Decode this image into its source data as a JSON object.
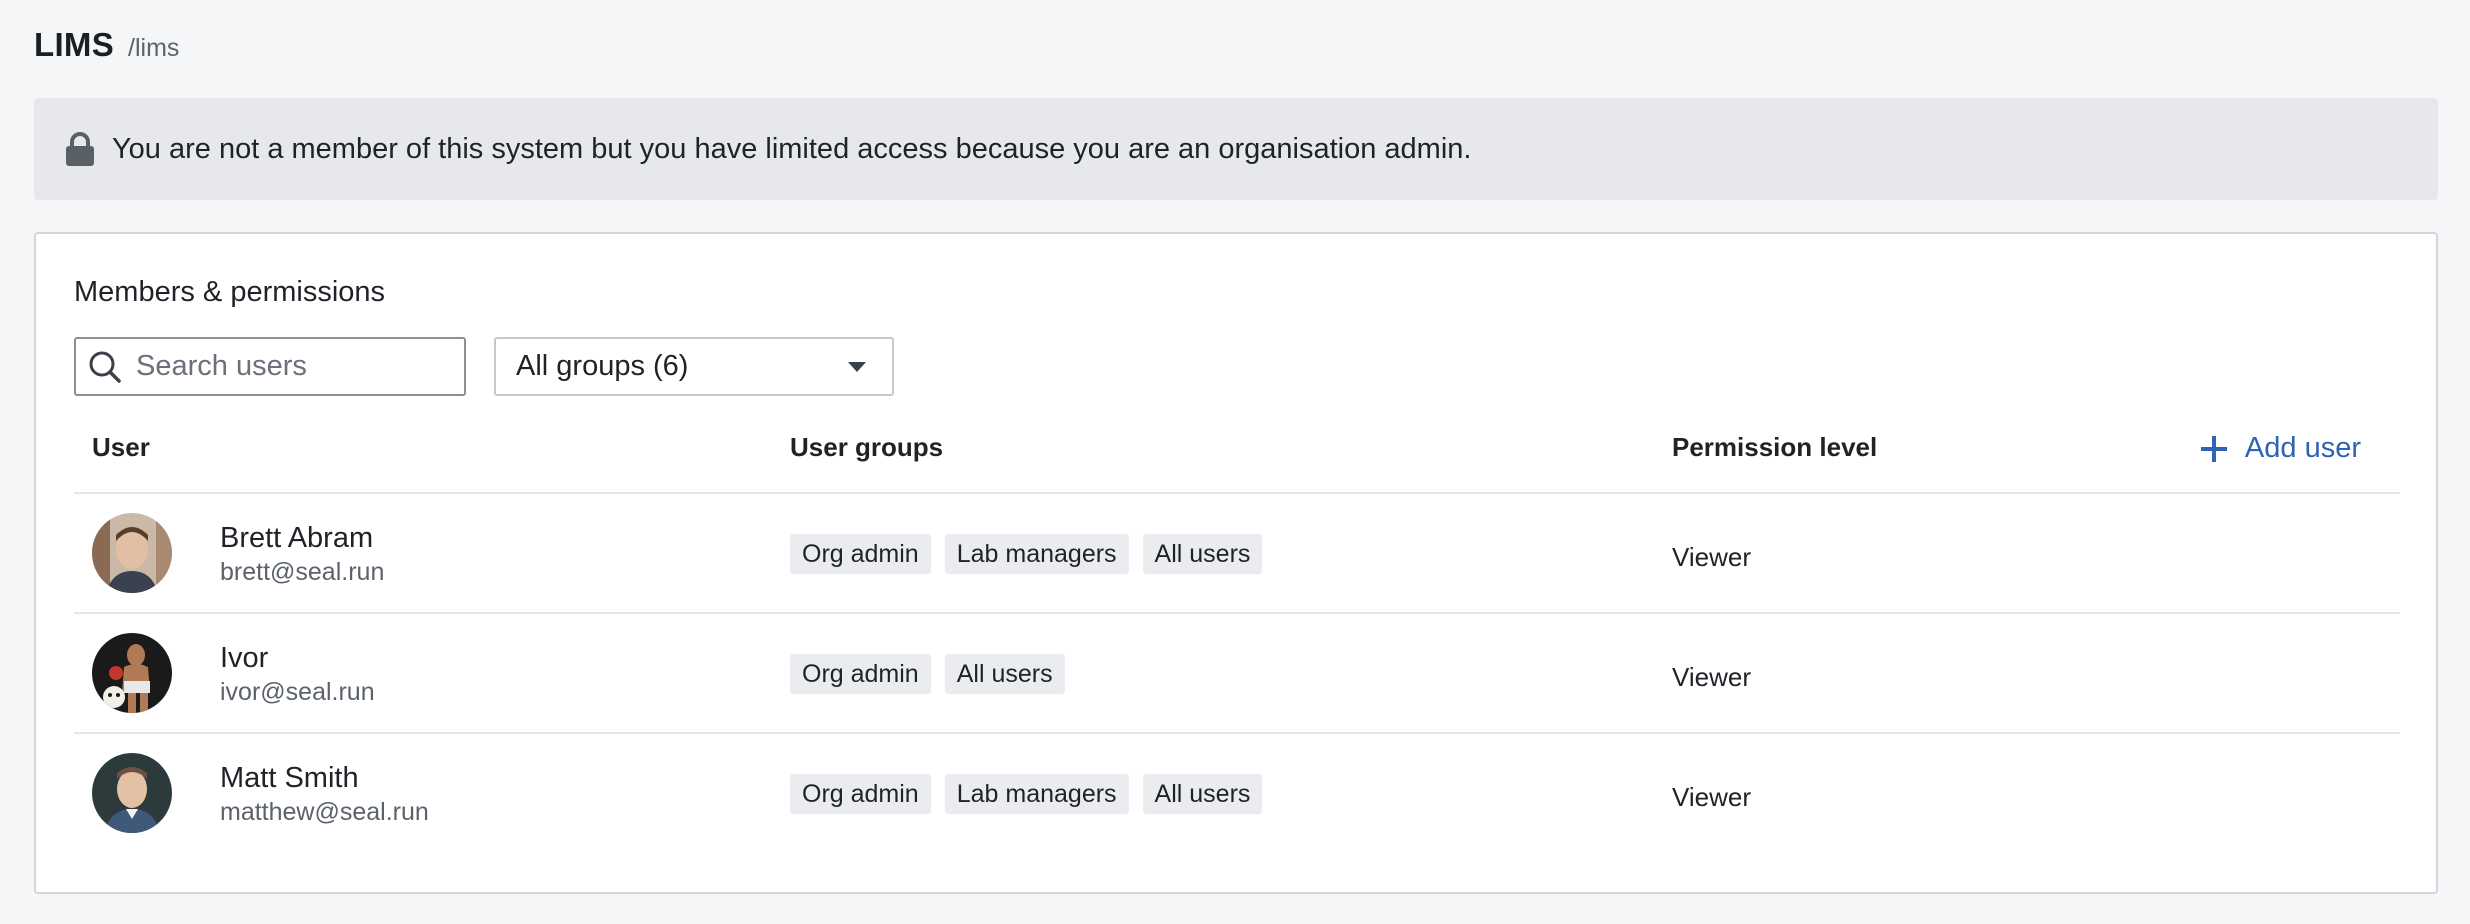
{
  "header": {
    "title": "LIMS",
    "path": "/lims"
  },
  "notice": {
    "text": "You are not a member of this system but you have limited access because you are an organisation admin."
  },
  "members": {
    "title": "Members & permissions",
    "search_placeholder": "Search users",
    "group_filter": "All groups (6)",
    "columns": {
      "user": "User",
      "groups": "User groups",
      "permission": "Permission level"
    },
    "add_user_label": "Add user",
    "rows": [
      {
        "name": "Brett Abram",
        "email": "brett@seal.run",
        "groups": [
          "Org admin",
          "Lab managers",
          "All users"
        ],
        "permission": "Viewer"
      },
      {
        "name": "Ivor",
        "email": "ivor@seal.run",
        "groups": [
          "Org admin",
          "All users"
        ],
        "permission": "Viewer"
      },
      {
        "name": "Matt Smith",
        "email": "matthew@seal.run",
        "groups": [
          "Org admin",
          "Lab managers",
          "All users"
        ],
        "permission": "Viewer"
      }
    ]
  },
  "colors": {
    "accent": "#2f63b5",
    "notice_bg": "#e6e8eb",
    "tag_bg": "#eaecef"
  },
  "icons": {
    "notice": "lock-icon",
    "search": "search-icon",
    "add": "plus-icon",
    "select": "chevron-down-icon"
  }
}
